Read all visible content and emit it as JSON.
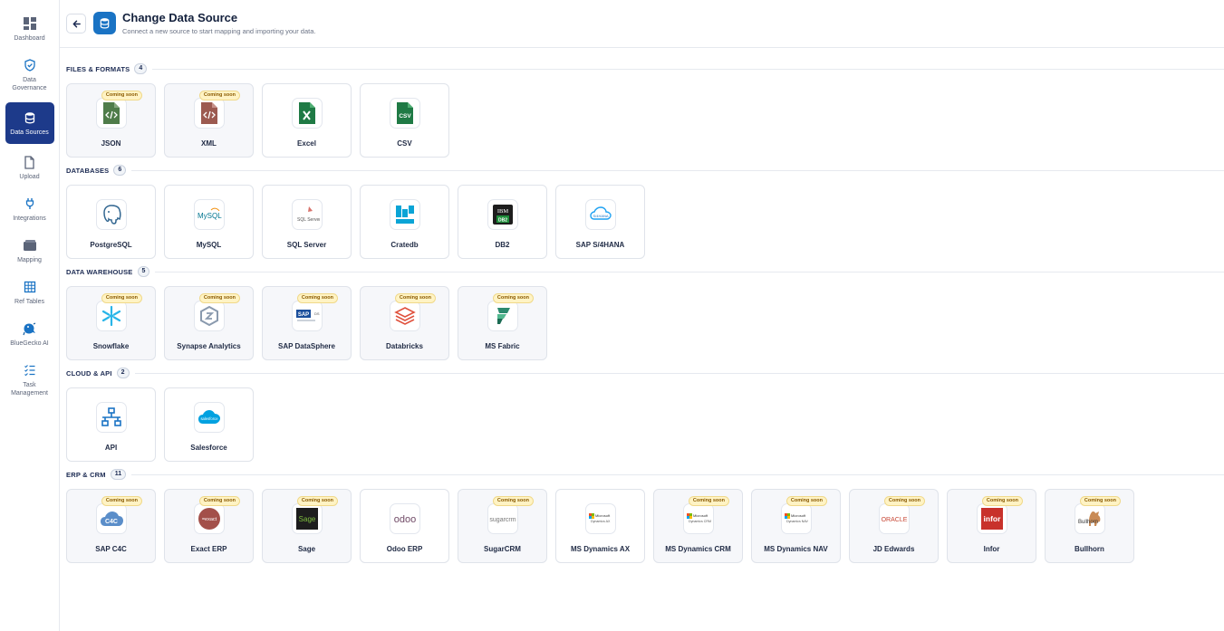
{
  "sidebar": {
    "items": [
      {
        "label": "Dashboard",
        "icon": "dashboard-icon",
        "active": false
      },
      {
        "label": "Data\nGovernance",
        "icon": "shield-icon",
        "active": false
      },
      {
        "label": "Data Sources",
        "icon": "database-icon",
        "active": true
      },
      {
        "label": "Upload",
        "icon": "file-icon",
        "active": false
      },
      {
        "label": "Integrations",
        "icon": "plug-icon",
        "active": false
      },
      {
        "label": "Mapping",
        "icon": "folder-icon",
        "active": false
      },
      {
        "label": "Ref Tables",
        "icon": "table-icon",
        "active": false
      },
      {
        "label": "BlueGecko AI",
        "icon": "gecko-icon",
        "active": false
      },
      {
        "label": "Task\nManagement",
        "icon": "checklist-icon",
        "active": false
      }
    ]
  },
  "header": {
    "title": "Change Data Source",
    "subtitle": "Connect a new source to start mapping and importing your data."
  },
  "coming_soon_label": "Coming soon",
  "sections": [
    {
      "title": "FILES & FORMATS",
      "count": "4",
      "cards": [
        {
          "label": "JSON",
          "icon": "json-file-icon",
          "coming_soon": true
        },
        {
          "label": "XML",
          "icon": "xml-file-icon",
          "coming_soon": true
        },
        {
          "label": "Excel",
          "icon": "excel-icon",
          "coming_soon": false
        },
        {
          "label": "CSV",
          "icon": "csv-file-icon",
          "coming_soon": false
        }
      ]
    },
    {
      "title": "DATABASES",
      "count": "6",
      "cards": [
        {
          "label": "PostgreSQL",
          "icon": "postgresql-logo-icon",
          "coming_soon": false
        },
        {
          "label": "MySQL",
          "icon": "mysql-logo-icon",
          "coming_soon": false
        },
        {
          "label": "SQL Server",
          "icon": "sql-server-logo-icon",
          "coming_soon": false
        },
        {
          "label": "Cratedb",
          "icon": "cratedb-logo-icon",
          "coming_soon": false
        },
        {
          "label": "DB2",
          "icon": "ibm-db2-logo-icon",
          "coming_soon": false
        },
        {
          "label": "SAP S/4HANA",
          "icon": "sap-s4hana-logo-icon",
          "coming_soon": false
        }
      ]
    },
    {
      "title": "DATA WAREHOUSE",
      "count": "5",
      "cards": [
        {
          "label": "Snowflake",
          "icon": "snowflake-logo-icon",
          "coming_soon": true
        },
        {
          "label": "Synapse Analytics",
          "icon": "synapse-logo-icon",
          "coming_soon": true
        },
        {
          "label": "SAP DataSphere",
          "icon": "sap-datasphere-logo-icon",
          "coming_soon": true
        },
        {
          "label": "Databricks",
          "icon": "databricks-logo-icon",
          "coming_soon": true
        },
        {
          "label": "MS Fabric",
          "icon": "ms-fabric-logo-icon",
          "coming_soon": true
        }
      ]
    },
    {
      "title": "CLOUD & API",
      "count": "2",
      "cards": [
        {
          "label": "API",
          "icon": "api-network-icon",
          "coming_soon": false
        },
        {
          "label": "Salesforce",
          "icon": "salesforce-logo-icon",
          "coming_soon": false
        }
      ]
    },
    {
      "title": "ERP & CRM",
      "count": "11",
      "cards": [
        {
          "label": "SAP C4C",
          "icon": "sap-c4c-logo-icon",
          "coming_soon": true
        },
        {
          "label": "Exact ERP",
          "icon": "exact-logo-icon",
          "coming_soon": true
        },
        {
          "label": "Sage",
          "icon": "sage-logo-icon",
          "coming_soon": true
        },
        {
          "label": "Odoo ERP",
          "icon": "odoo-logo-icon",
          "coming_soon": false
        },
        {
          "label": "SugarCRM",
          "icon": "sugarcrm-logo-icon",
          "coming_soon": true
        },
        {
          "label": "MS Dynamics AX",
          "icon": "ms-dynamics-ax-logo-icon",
          "coming_soon": false
        },
        {
          "label": "MS Dynamics CRM",
          "icon": "ms-dynamics-crm-logo-icon",
          "coming_soon": true
        },
        {
          "label": "MS Dynamics NAV",
          "icon": "ms-dynamics-nav-logo-icon",
          "coming_soon": true
        },
        {
          "label": "JD Edwards",
          "icon": "jd-edwards-logo-icon",
          "coming_soon": true
        },
        {
          "label": "Infor",
          "icon": "infor-logo-icon",
          "coming_soon": true
        },
        {
          "label": "Bullhorn",
          "icon": "bullhorn-logo-icon",
          "coming_soon": true
        }
      ]
    }
  ],
  "colors": {
    "active_nav": "#1d3a8a",
    "title_icon_bg": "#1a73c4",
    "coming_soon_bg": "#fff3c4",
    "coming_soon_text": "#8a5a00"
  }
}
